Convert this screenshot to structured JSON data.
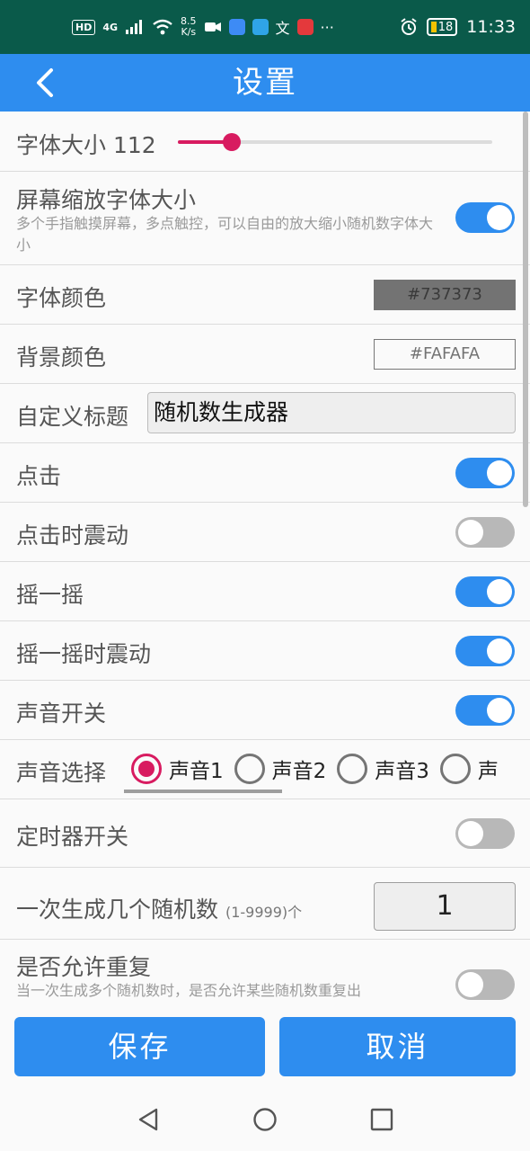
{
  "status_bar": {
    "hd_badge": "HD",
    "network_type": "4G",
    "net_speed_value": "8.5",
    "net_speed_unit": "K/s",
    "battery_level": "18",
    "time": "11:33",
    "more_indicator": "···"
  },
  "app_bar": {
    "title": "设置"
  },
  "settings": {
    "font_size": {
      "label": "字体大小",
      "value": "112",
      "slider_fraction": 0.17
    },
    "screen_zoom": {
      "label": "屏幕缩放字体大小",
      "description": "多个手指触摸屏幕，多点触控，可以自由的放大缩小随机数字体大小",
      "on": true
    },
    "font_color": {
      "label": "字体颜色",
      "value": "#737373"
    },
    "background_color": {
      "label": "背景颜色",
      "value": "#FAFAFA"
    },
    "custom_title": {
      "label": "自定义标题",
      "value": "随机数生成器"
    },
    "click": {
      "label": "点击",
      "on": true
    },
    "click_vibrate": {
      "label": "点击时震动",
      "on": false
    },
    "shake": {
      "label": "摇一摇",
      "on": true
    },
    "shake_vibrate": {
      "label": "摇一摇时震动",
      "on": true
    },
    "sound_switch": {
      "label": "声音开关",
      "on": true
    },
    "sound_select": {
      "label": "声音选择",
      "options": [
        "声音1",
        "声音2",
        "声音3",
        "声"
      ],
      "selected_index": 0
    },
    "timer_switch": {
      "label": "定时器开关",
      "on": false
    },
    "count": {
      "label": "一次生成几个随机数",
      "range": "(1-9999)个",
      "value": "1"
    },
    "allow_repeat": {
      "label": "是否允许重复",
      "description": "当一次生成多个随机数时，是否允许某些随机数重复出",
      "on": false
    }
  },
  "buttons": {
    "save": "保存",
    "cancel": "取消"
  },
  "colors": {
    "status_bar_bg": "#0A5A4A",
    "app_bar_bg": "#2E8DEF",
    "accent": "#D81B60",
    "toggle_on": "#2E8DEF",
    "toggle_off": "#B8B8B8"
  },
  "icons": {
    "back": "chevron-left-icon",
    "nav_back": "triangle-back-icon",
    "nav_home": "circle-home-icon",
    "nav_recents": "square-recents-icon"
  }
}
